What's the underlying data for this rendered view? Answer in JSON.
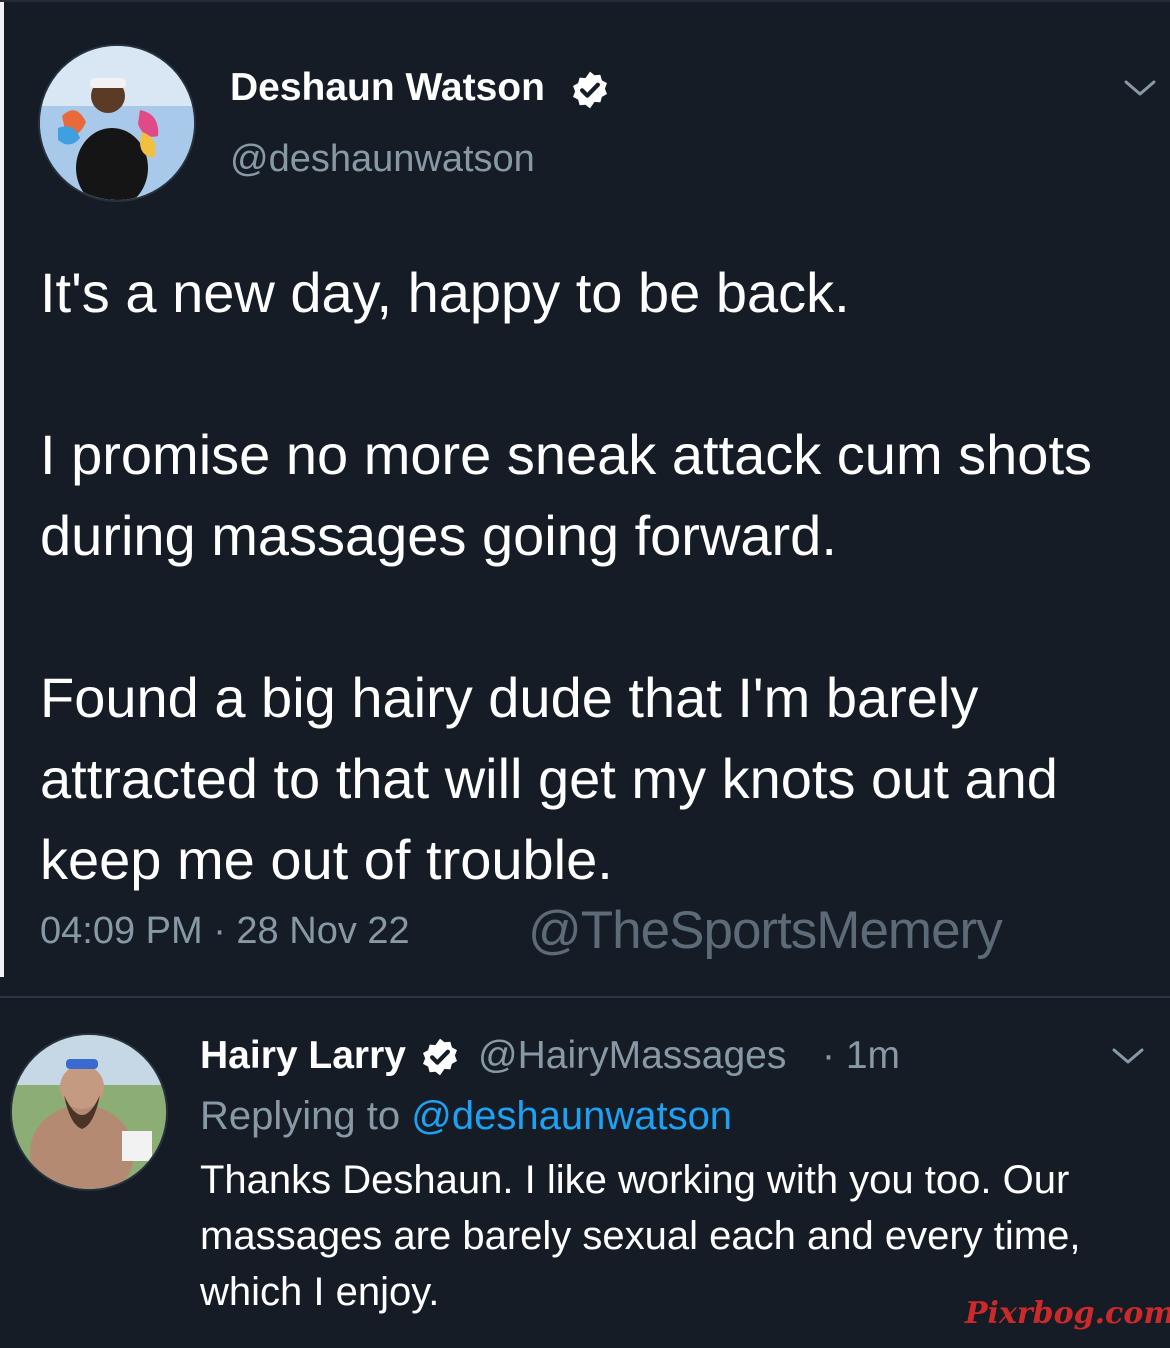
{
  "tweet": {
    "author_name": "Deshaun Watson",
    "author_handle": "@deshaunwatson",
    "paragraphs": [
      "It's a new day, happy to be back.",
      "I promise no more sneak attack cum shots during massages going forward.",
      "Found a big hairy dude that I'm barely attracted to that will get my knots out and keep me out of trouble."
    ],
    "timestamp": "04:09 PM · 28 Nov 22",
    "watermark": "@TheSportsMemery"
  },
  "reply": {
    "author_name": "Hairy Larry",
    "author_handle": "@HairyMassages",
    "age": "· 1m",
    "replying_prefix": "Replying to ",
    "replying_mention": "@deshaunwatson",
    "text": "Thanks Deshaun. I like working with you too. Our massages are barely sexual each and every time, which I enjoy."
  },
  "site_watermark": "Pixrbog.com",
  "colors": {
    "background": "#151c26",
    "secondary_text": "#8899a6",
    "link": "#1da1f2",
    "verified_badge": "#ffffff"
  },
  "icons": [
    "verified-icon",
    "chevron-down-icon"
  ]
}
